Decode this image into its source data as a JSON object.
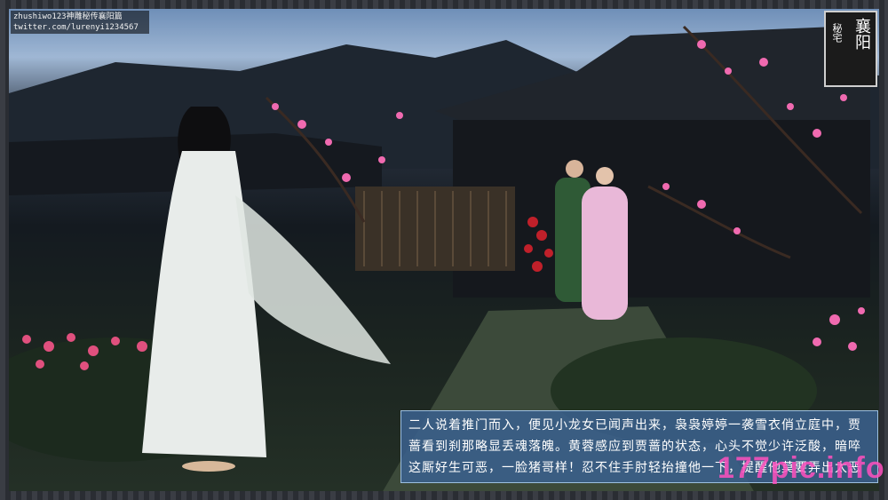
{
  "watermark": {
    "line1": "zhushiwo123神雕秘传襄阳篇",
    "line2": "twitter.com/lurenyi1234567"
  },
  "seal": {
    "left_text": "秘宅",
    "right_text": "襄阳"
  },
  "caption": {
    "text": "二人说着推门而入，便见小龙女已闻声出来，袅袅婷婷一袭雪衣俏立庭中，贾蔷看到刹那略显丢魂落魄。黄蓉感应到贾蔷的状态，心头不觉少许泛酸，暗啐这厮好生可恶，一脸猪哥样！忍不住手肘轻抬撞他一下，提醒他莫要弄出太恶心的模样丢自己的脸"
  },
  "site_watermark": {
    "text": "177pic.info"
  },
  "colors": {
    "caption_bg": "#3a608c",
    "site_mark": "#ff50be",
    "blossom": "#f06ab0"
  }
}
